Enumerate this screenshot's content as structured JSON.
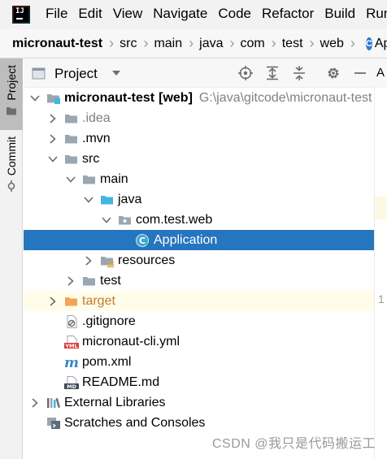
{
  "menubar": {
    "items": [
      "File",
      "Edit",
      "View",
      "Navigate",
      "Code",
      "Refactor",
      "Build",
      "Run"
    ]
  },
  "breadcrumb": {
    "items": [
      "micronaut-test",
      "src",
      "main",
      "java",
      "com",
      "test",
      "web",
      "Application"
    ]
  },
  "side_stripe": {
    "project_label": "Project",
    "commit_label": "Commit"
  },
  "panel": {
    "title": "Project"
  },
  "tree": [
    {
      "label": "micronaut-test",
      "badge": "[web]",
      "path": "G:\\java\\gitcode\\micronaut-test",
      "icon": "module-folder-icon"
    },
    {
      "label": ".idea",
      "icon": "folder-icon"
    },
    {
      "label": ".mvn",
      "icon": "folder-icon"
    },
    {
      "label": "src",
      "icon": "folder-icon"
    },
    {
      "label": "main",
      "icon": "folder-icon"
    },
    {
      "label": "java",
      "icon": "source-folder-icon"
    },
    {
      "label": "com.test.web",
      "icon": "package-icon"
    },
    {
      "label": "Application",
      "icon": "class-icon"
    },
    {
      "label": "resources",
      "icon": "resources-folder-icon"
    },
    {
      "label": "test",
      "icon": "folder-icon"
    },
    {
      "label": "target",
      "icon": "excluded-folder-icon"
    },
    {
      "label": ".gitignore",
      "icon": "ignore-file-icon"
    },
    {
      "label": "micronaut-cli.yml",
      "icon": "yml-file-icon"
    },
    {
      "label": "pom.xml",
      "icon": "maven-file-icon"
    },
    {
      "label": "README.md",
      "icon": "markdown-file-icon"
    },
    {
      "label": "External Libraries",
      "icon": "libraries-icon"
    },
    {
      "label": "Scratches and Consoles",
      "icon": "scratches-icon"
    }
  ],
  "editor": {
    "tab_initial": "A",
    "line_number": "1"
  },
  "watermark": "CSDN @我只是代码搬运工",
  "colors": {
    "selection": "#2675bf",
    "excluded": "#c27d2a",
    "folder": "#9aa7b0",
    "source_folder": "#40b6e0"
  }
}
